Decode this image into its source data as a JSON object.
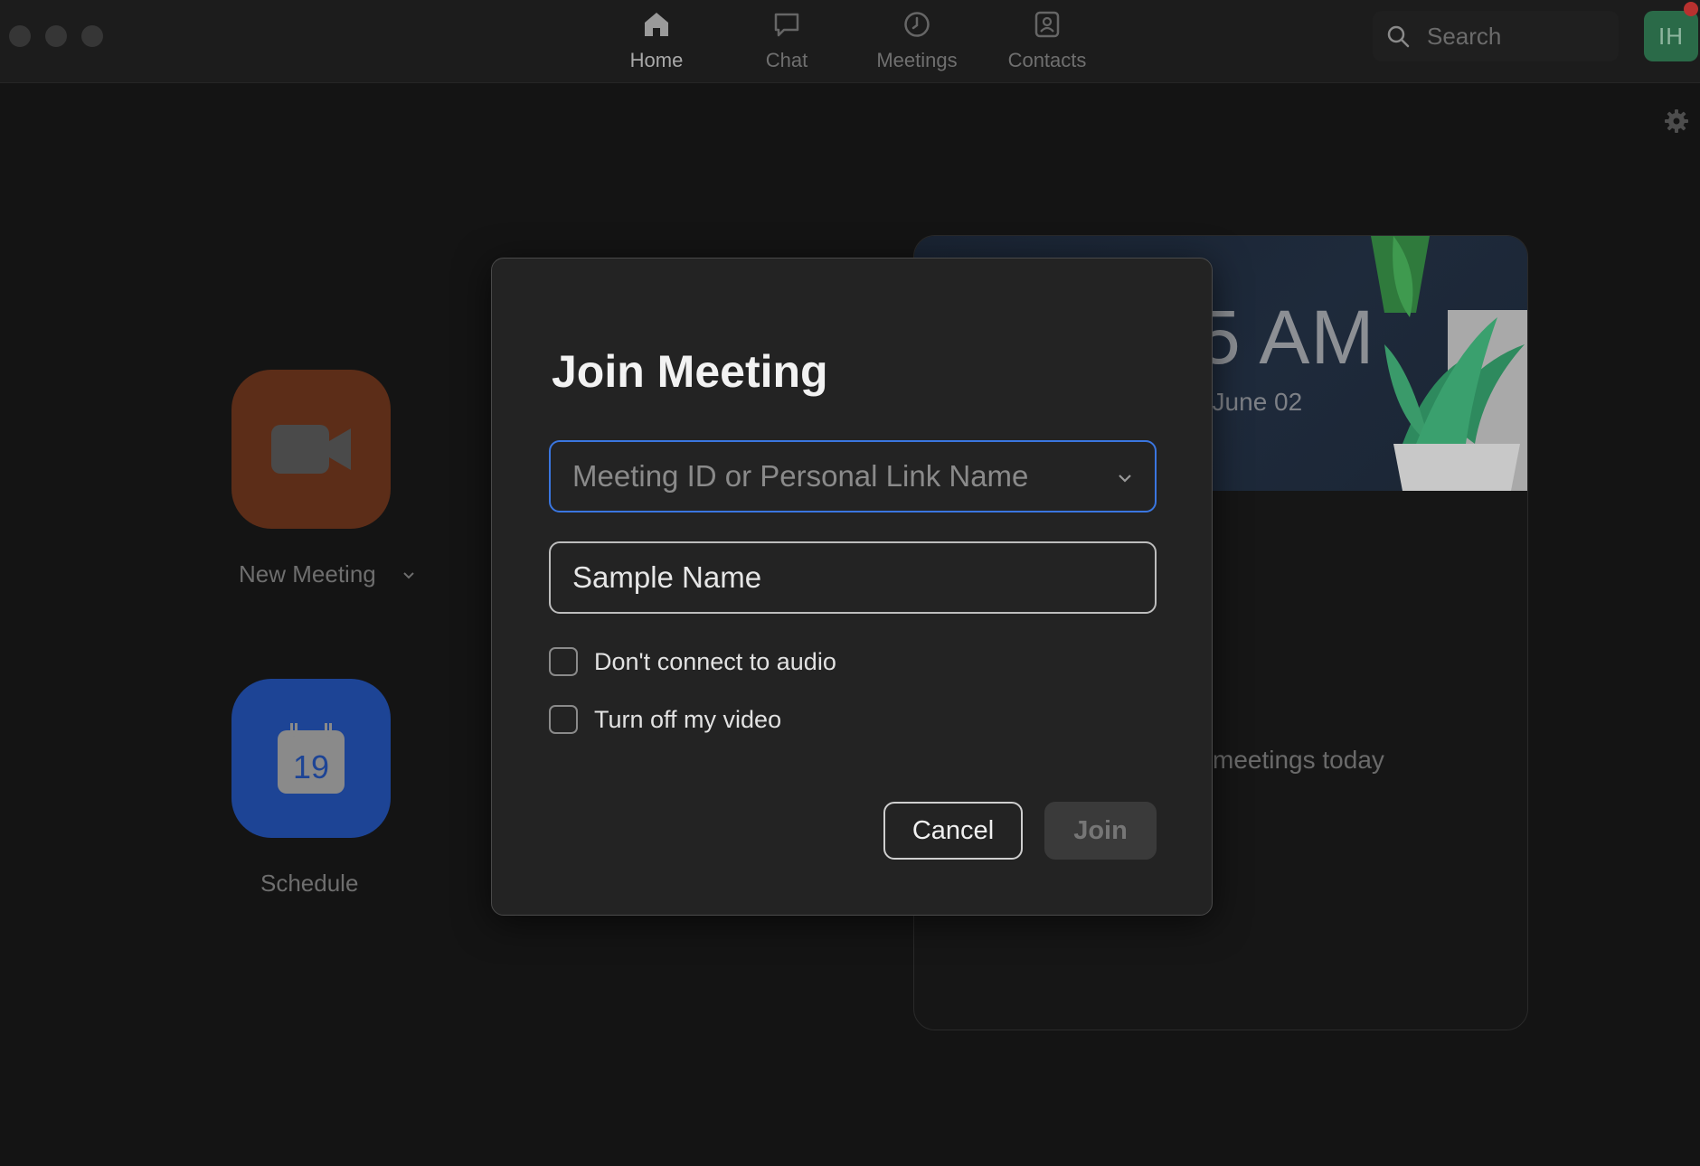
{
  "nav": {
    "tabs": [
      {
        "label": "Home",
        "icon": "home-icon",
        "active": true
      },
      {
        "label": "Chat",
        "icon": "chat-icon"
      },
      {
        "label": "Meetings",
        "icon": "clock-icon"
      },
      {
        "label": "Contacts",
        "icon": "contacts-icon"
      }
    ],
    "search_placeholder": "Search",
    "avatar_initials": "IH"
  },
  "home": {
    "new_meeting_label": "New Meeting",
    "schedule_label": "Schedule",
    "calendar_day": "19",
    "clock_partial": "5 AM",
    "date_partial": ", June 02",
    "no_meetings_partial": "meetings today"
  },
  "dialog": {
    "title": "Join Meeting",
    "meeting_id_placeholder": "Meeting ID or Personal Link Name",
    "name_value": "Sample Name",
    "checkbox_audio_label": "Don't connect to audio",
    "checkbox_video_label": "Turn off my video",
    "cancel_label": "Cancel",
    "join_label": "Join"
  },
  "colors": {
    "accent_blue": "#3a76e0",
    "new_meeting_tile": "#5c2d18",
    "schedule_tile": "#1d4495",
    "avatar_bg": "#2a6a48",
    "notification": "#b8312f"
  }
}
